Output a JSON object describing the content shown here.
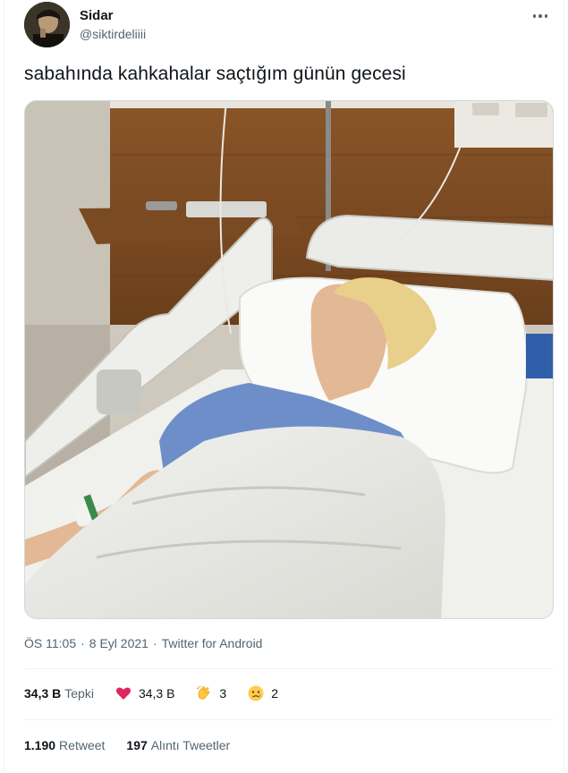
{
  "author": {
    "display_name": "Sidar",
    "handle": "@siktirdeliiii"
  },
  "tweet": {
    "text": "sabahında kahkahalar saçtığım günün gecesi",
    "time": "ÖS 11:05",
    "date": "8 Eyl 2021",
    "separator": "·",
    "source": "Twitter for Android"
  },
  "reactions": {
    "total_count": "34,3 B",
    "total_label": "Tepki",
    "heart_count": "34,3 B",
    "clap_count": "3",
    "sad_count": "2"
  },
  "engagement": {
    "retweet_count": "1.190",
    "retweet_label": "Retweet",
    "quote_count": "197",
    "quote_label": "Alıntı Tweetler"
  },
  "icons": {
    "more": "more-horizontal-icon",
    "heart": "heart-emoji-icon",
    "clap": "clapping-hands-emoji-icon",
    "sad": "sad-face-emoji-icon"
  },
  "colors": {
    "text_primary": "#0f1419",
    "text_secondary": "#536471",
    "divider": "#eff3f4",
    "heart": "#e0245e"
  }
}
